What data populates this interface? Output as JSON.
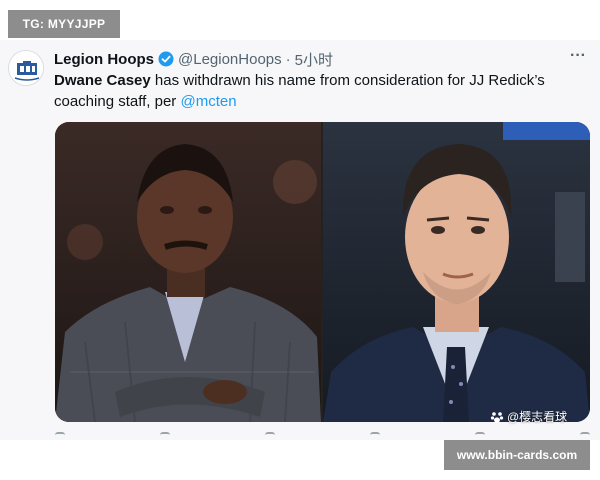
{
  "overlay": {
    "tg_tag": "TG: MYYJJPP",
    "site_tag": "www.bbin-cards.com",
    "watermark": "@樱志看球"
  },
  "tweet": {
    "display_name": "Legion Hoops",
    "handle": "@LegionHoops",
    "separator": "·",
    "timestamp": "5小时",
    "verified": true,
    "text": {
      "name": "Dwane Casey",
      "body": " has withdrawn his name from consideration for JJ Redick’s coaching staff, per ",
      "mention": "@mcten"
    },
    "media": [
      {
        "icon": "photo-dwane-casey"
      },
      {
        "icon": "photo-jj-redick"
      }
    ],
    "colors": {
      "accent": "#1d9bf0",
      "text": "#0f1419",
      "muted": "#536471"
    }
  }
}
